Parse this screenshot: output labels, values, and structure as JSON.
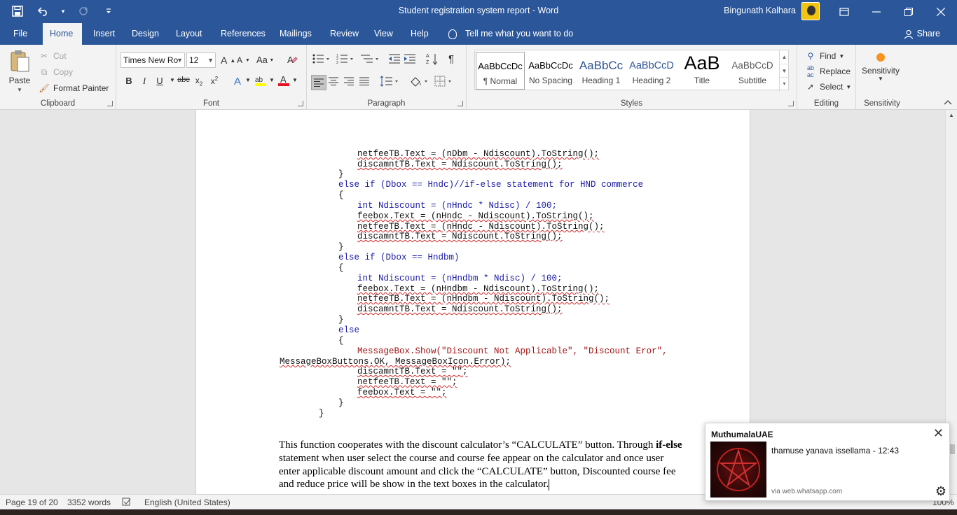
{
  "window": {
    "title": "Student registration system report  -  Word",
    "user": "Bingunath Kalhara",
    "controls": {
      "display_options": "▣",
      "minimize": "—",
      "restore": "❐",
      "close": "✕"
    }
  },
  "qat": {
    "save": "💾",
    "undo": "↶",
    "redo": "↻",
    "customize": "▾"
  },
  "tabs": [
    "File",
    "Home",
    "Insert",
    "Design",
    "Layout",
    "References",
    "Mailings",
    "Review",
    "View",
    "Help"
  ],
  "active_tab": "Home",
  "tell_me": "Tell me what you want to do",
  "share": "Share",
  "ribbon": {
    "clipboard": {
      "paste": "Paste",
      "cut": "Cut",
      "copy": "Copy",
      "format_painter": "Format Painter",
      "label": "Clipboard"
    },
    "font": {
      "family": "Times New Ro",
      "size": "12",
      "label": "Font"
    },
    "paragraph": {
      "label": "Paragraph"
    },
    "styles": {
      "items": [
        {
          "preview": "AaBbCcDc",
          "name": "¶ Normal"
        },
        {
          "preview": "AaBbCcDc",
          "name": "No Spacing"
        },
        {
          "preview": "AaBbCc",
          "name": "Heading 1"
        },
        {
          "preview": "AaBbCcD",
          "name": "Heading 2"
        },
        {
          "preview": "AaB",
          "name": "Title"
        },
        {
          "preview": "AaBbCcD",
          "name": "Subtitle"
        }
      ],
      "label": "Styles"
    },
    "editing": {
      "find": "Find",
      "replace": "Replace",
      "select": "Select",
      "label": "Editing"
    },
    "sensitivity": {
      "button": "Sensitivity",
      "label": "Sensitivity"
    }
  },
  "document": {
    "code_lines": [
      "netfeeTB.Text = (nDbm - Ndiscount).ToString();",
      "discamntTB.Text = Ndiscount.ToString();",
      "}",
      "else if (Dbox == Hndc)//if-else statement for HND commerce",
      "{",
      "int Ndiscount = (nHndc * Ndisc) / 100;",
      "feebox.Text = (nHndc - Ndiscount).ToString();",
      "netfeeTB.Text = (nHndc - Ndiscount).ToString();",
      "discamntTB.Text = Ndiscount.ToString();",
      "}",
      "else if (Dbox == Hndbm)",
      "{",
      "int Ndiscount = (nHndbm * Ndisc) / 100;",
      "feebox.Text = (nHndbm - Ndiscount).ToString();",
      "netfeeTB.Text = (nHndbm - Ndiscount).ToString();",
      "discamntTB.Text = Ndiscount.ToString();",
      "}",
      "else",
      "{",
      "MessageBox.Show(\"Discount Not Applicable\", \"Discount Eror\",",
      "MessageBoxButtons.OK, MessageBoxIcon.Error);",
      "discamntTB.Text = \"\";",
      "netfeeTB.Text = \"\";",
      "feebox.Text = \"\";",
      "}",
      "}"
    ],
    "paragraph": {
      "part1": "This function cooperates with the discount calculator’s “CALCULATE” button. Through ",
      "bold": "if-else",
      "part2": " statement when user select the course and course fee appear on the calculator and once user enter applicable discount amount and click the “CALCULATE” button, Discounted course fee and reduce price will be show in the text boxes in the calculator."
    }
  },
  "status": {
    "page": "Page 19 of 20",
    "words": "3352 words",
    "language": "English (United States)",
    "zoom": "100%"
  },
  "notification": {
    "app": "MuthumalaUAE",
    "message": "thamuse yanava issellama - 12:43",
    "via": "via web.whatsapp.com"
  }
}
